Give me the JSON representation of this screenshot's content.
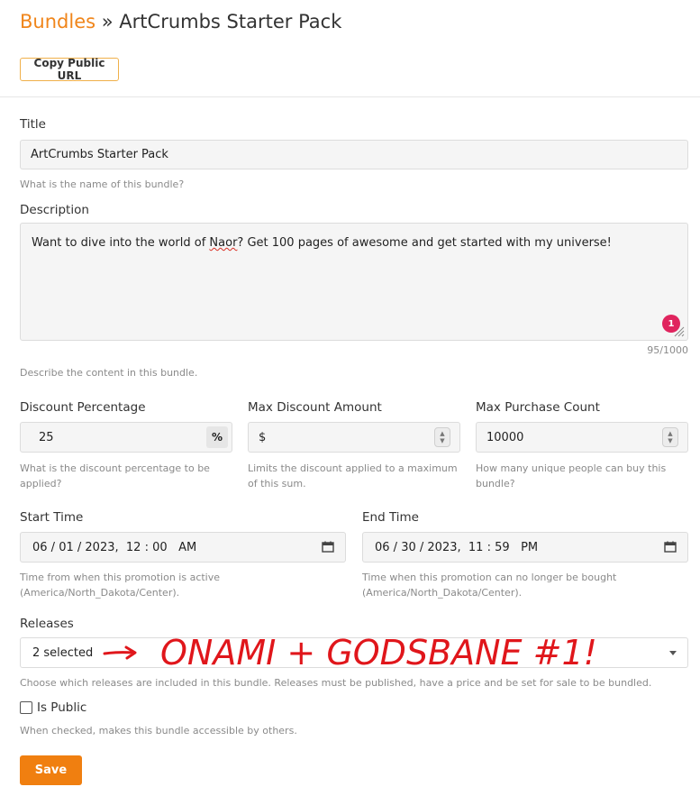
{
  "breadcrumb": {
    "parent": "Bundles",
    "separator": "»",
    "current": "ArtCrumbs Starter Pack"
  },
  "toolbar": {
    "copy_url_label": "Copy Public URL"
  },
  "title_field": {
    "label": "Title",
    "value": "ArtCrumbs Starter Pack",
    "help": "What is the name of this bundle?"
  },
  "description_field": {
    "label": "Description",
    "value_before": "Want to dive into the world of ",
    "value_misspelled": "Naor",
    "value_after": "? Get 100 pages of awesome and get started with my universe!",
    "badge": "1",
    "counter": "95/1000",
    "help": "Describe the content in this bundle."
  },
  "discount_field": {
    "label": "Discount Percentage",
    "value": "25",
    "suffix": "%",
    "help": "What is the discount percentage to be applied?"
  },
  "max_discount_field": {
    "label": "Max Discount Amount",
    "prefix": "$",
    "value": "",
    "help": "Limits the discount applied to a maximum of this sum."
  },
  "max_purchase_field": {
    "label": "Max Purchase Count",
    "value": "10000",
    "help": "How many unique people can buy this bundle?"
  },
  "start_time_field": {
    "label": "Start Time",
    "month": "06",
    "day": "01",
    "year": "2023",
    "hour": "12",
    "minute": "00",
    "ampm": "AM",
    "help": "Time from when this promotion is active (America/North_Dakota/Center)."
  },
  "end_time_field": {
    "label": "End Time",
    "month": "06",
    "day": "30",
    "year": "2023",
    "hour": "11",
    "minute": "59",
    "ampm": "PM",
    "help": "Time when this promotion can no longer be bought (America/North_Dakota/Center)."
  },
  "releases_field": {
    "label": "Releases",
    "value": "2 selected",
    "help": "Choose which releases are included in this bundle. Releases must be published, have a price and be set for sale to be bundled."
  },
  "annotation": {
    "text": "ONAMI + GODSBANE #1!",
    "color": "#e0161b"
  },
  "public_field": {
    "label": "Is Public",
    "checked": false,
    "help": "When checked, makes this bundle accessible by others."
  },
  "actions": {
    "save_label": "Save"
  },
  "colors": {
    "accent": "#f07f10",
    "link": "#f0851a",
    "badge": "#e0245e"
  }
}
